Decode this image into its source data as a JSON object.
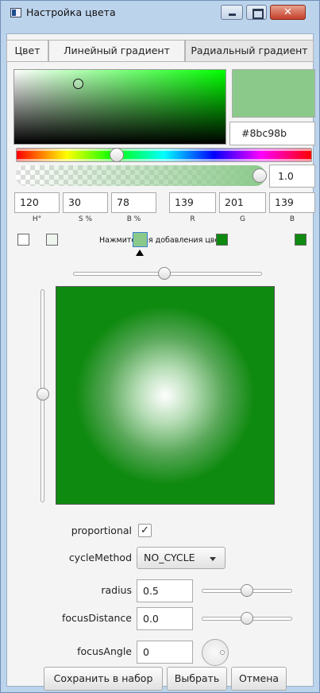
{
  "window": {
    "title": "Настройка цвета",
    "close_glyph": "✕"
  },
  "tabs": [
    {
      "label": "Цвет"
    },
    {
      "label": "Линейный градиент"
    },
    {
      "label": "Радиальный градиент",
      "active": true
    }
  ],
  "color": {
    "hex": "#8bc98b",
    "alpha": "1.0",
    "preview": "#8bc98b"
  },
  "fields": {
    "h": "120",
    "s": "30",
    "b": "78",
    "r": "139",
    "g": "201",
    "bl": "139",
    "labels": {
      "h": "H°",
      "s": "S %",
      "b": "B %",
      "r": "R",
      "g": "G",
      "bl": "B"
    }
  },
  "swatches": {
    "hint": "Нажмите для добавления цвета",
    "colors": [
      "#ffffff",
      "#eef5ee",
      "#8bc98b",
      "#0f8a10",
      "#0f8a10"
    ]
  },
  "gradient": {
    "center_color": "#ffffff",
    "edge_color": "#0f8a10",
    "proportional_label": "proportional",
    "proportional_checked": "✓",
    "cycle_label": "cycleMethod",
    "cycle_value": "NO_CYCLE",
    "radius_label": "radius",
    "radius_value": "0.5",
    "focus_distance_label": "focusDistance",
    "focus_distance_value": "0.0",
    "focus_angle_label": "focusAngle",
    "focus_angle_value": "0"
  },
  "buttons": {
    "save": "Сохранить в набор",
    "select": "Выбрать",
    "cancel": "Отмена"
  }
}
